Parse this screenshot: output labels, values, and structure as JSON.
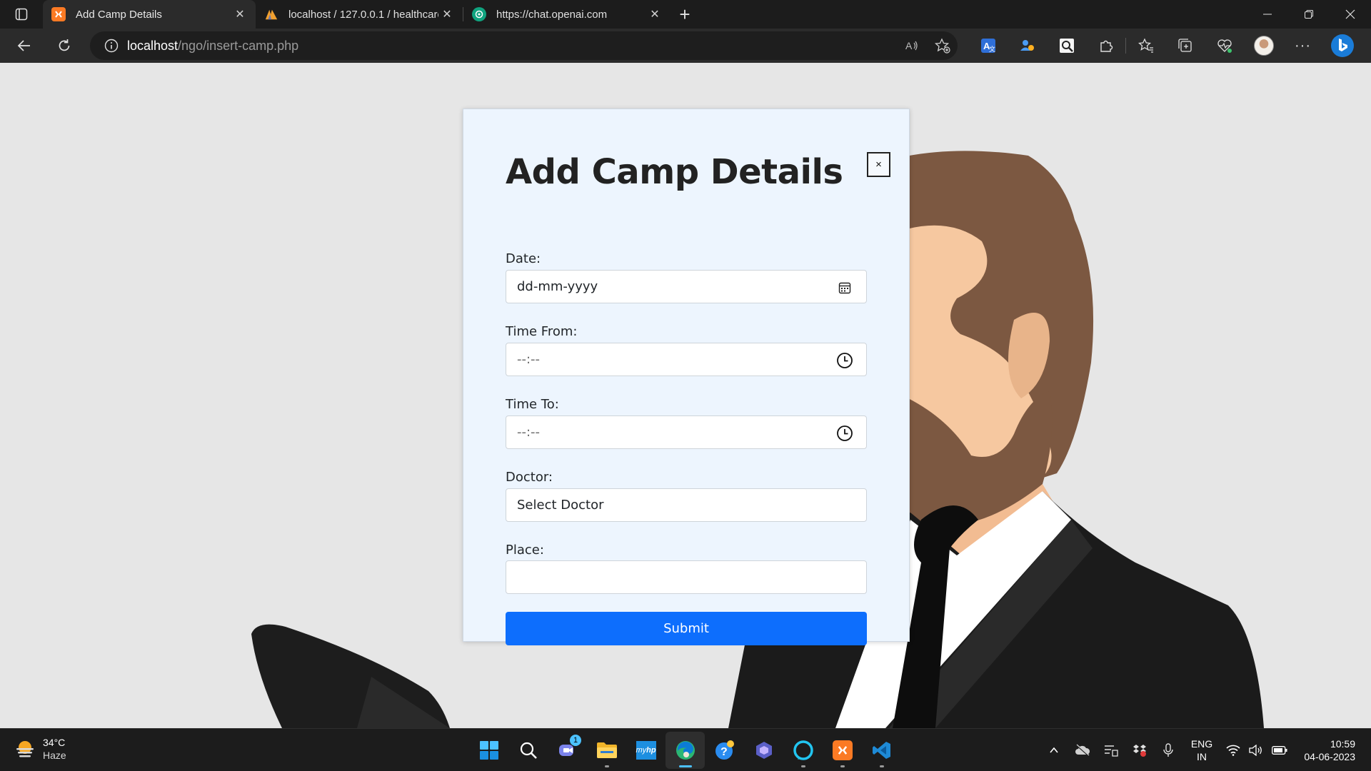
{
  "browser": {
    "tabs": [
      {
        "title": "Add Camp Details",
        "favicon": "xampp-icon",
        "active": true
      },
      {
        "title": "localhost / 127.0.0.1 / healthcare",
        "favicon": "phpmyadmin-icon",
        "active": false
      },
      {
        "title": "https://chat.openai.com",
        "favicon": "openai-icon",
        "active": false
      }
    ],
    "address": {
      "host": "localhost",
      "path": "/ngo/insert-camp.php"
    }
  },
  "form": {
    "title": "Add Camp Details",
    "close_label": "×",
    "fields": {
      "date": {
        "label": "Date:",
        "value": "dd-mm-yyyy"
      },
      "time_from": {
        "label": "Time From:",
        "value": "--:--"
      },
      "time_to": {
        "label": "Time To:",
        "value": "--:--"
      },
      "doctor": {
        "label": "Doctor:",
        "value": "Select Doctor"
      },
      "place": {
        "label": "Place:",
        "value": ""
      }
    },
    "submit_label": "Submit",
    "submit_color": "#0d6efd"
  },
  "taskbar": {
    "weather": {
      "temp": "34°C",
      "condition": "Haze"
    },
    "language": {
      "line1": "ENG",
      "line2": "IN"
    },
    "clock": {
      "time": "10:59",
      "date": "04-06-2023"
    },
    "chat_badge": "1"
  }
}
